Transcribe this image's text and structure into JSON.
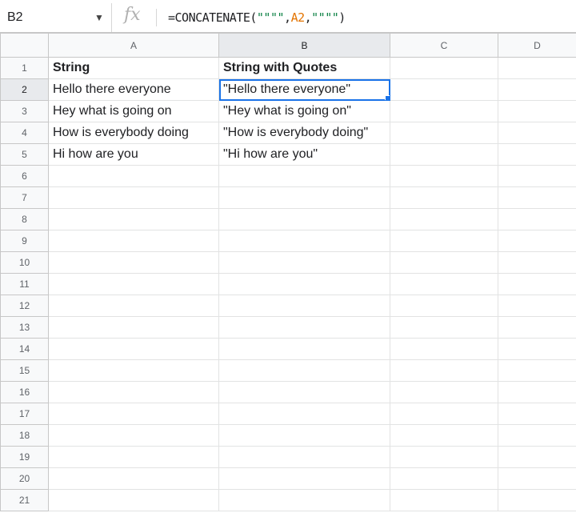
{
  "name_box": "B2",
  "formula": {
    "prefix": "=CONCATENATE(",
    "arg1": "\"\"\"\"",
    "sep1": ",",
    "arg2": "A2",
    "sep2": ",",
    "arg3": "\"\"\"\"",
    "suffix": ")"
  },
  "columns": [
    "A",
    "B",
    "C",
    "D"
  ],
  "rows": [
    "1",
    "2",
    "3",
    "4",
    "5",
    "6",
    "7",
    "8",
    "9",
    "10",
    "11",
    "12",
    "13",
    "14",
    "15",
    "16",
    "17",
    "18",
    "19",
    "20",
    "21"
  ],
  "cells": {
    "A1": "String",
    "B1": "String with Quotes",
    "A2": "Hello there everyone",
    "B2": "\"Hello there everyone\"",
    "A3": "Hey what is going on",
    "B3": "\"Hey what is going on\"",
    "A4": "How is everybody doing",
    "B4": "\"How is everybody doing\"",
    "A5": "Hi how are you",
    "B5": "\"Hi how are you\""
  },
  "colors": {
    "selection": "#1a73e8",
    "string_token": "#0b8043",
    "reference_token": "#e37400"
  }
}
